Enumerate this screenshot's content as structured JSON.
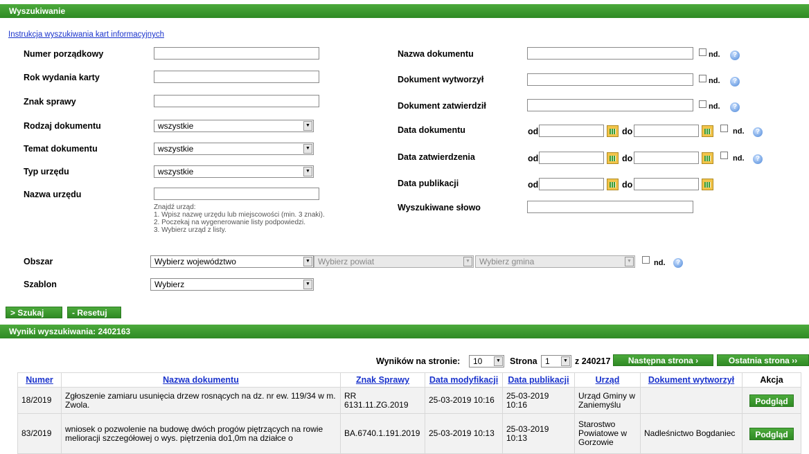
{
  "search_panel": {
    "title": "Wyszukiwanie",
    "instruction_link": "Instrukcja wyszukiwania kart informacyjnych",
    "left_fields": {
      "numer_label": "Numer porządkowy",
      "rok_label": "Rok wydania karty",
      "znak_label": "Znak sprawy",
      "rodzaj_label": "Rodzaj dokumentu",
      "rodzaj_value": "wszystkie",
      "temat_label": "Temat dokumentu",
      "temat_value": "wszystkie",
      "typ_label": "Typ urzędu",
      "typ_value": "wszystkie",
      "nazwa_urzedu_label": "Nazwa urzędu"
    },
    "hint_lines": [
      "Znajdź urząd:",
      "1. Wpisz nazwę urzędu lub miejscowości (min. 3 znaki).",
      "2. Poczekaj na wygenerowanie listy podpowiedzi.",
      "3. Wybierz urząd z listy."
    ],
    "right_fields": {
      "nazwa_dok_label": "Nazwa dokumentu",
      "wytworzyl_label": "Dokument wytworzył",
      "zatwierdzil_label": "Dokument zatwierdził",
      "data_dok_label": "Data dokumentu",
      "data_zatw_label": "Data zatwierdzenia",
      "data_publ_label": "Data publikacji",
      "slowo_label": "Wyszukiwane słowo"
    },
    "nd_label": "nd.",
    "od_label": "od",
    "do_label": "do",
    "obszar": {
      "label": "Obszar",
      "wojewodztwo": "Wybierz województwo",
      "powiat": "Wybierz powiat",
      "gmina": "Wybierz gmina"
    },
    "szablon": {
      "label": "Szablon",
      "value": "Wybierz"
    },
    "search_button": "> Szukaj",
    "reset_button": "- Resetuj"
  },
  "results": {
    "title": "Wyniki wyszukiwania: 2402163",
    "per_page_label": "Wyników na stronie:",
    "per_page_value": "10",
    "page_label": "Strona",
    "page_value": "1",
    "page_total": "z 240217",
    "next_button": "Następna strona ›",
    "last_button": "Ostatnia strona ››",
    "columns": [
      "Numer",
      "Nazwa dokumentu",
      "Znak Sprawy",
      "Data modyfikacji",
      "Data publikacji",
      "Urząd",
      "Dokument wytworzył",
      "Akcja"
    ],
    "rows": [
      {
        "numer": "18/2019",
        "nazwa": "Zgłoszenie zamiaru usunięcia drzew rosnących na dz. nr ew. 119/34 w m. Zwola.",
        "znak": "RR 6131.11.ZG.2019",
        "data_mod": "25-03-2019 10:16",
        "data_publ": "25-03-2019 10:16",
        "urzad": "Urząd Gminy w Zaniemyślu",
        "wytworzyl": "",
        "akcja": "Podgląd"
      },
      {
        "numer": "83/2019",
        "nazwa": "wniosek o pozwolenie na budowę dwóch progów piętrzących na rowie melioracji szczegółowej o wys. piętrzenia do1,0m na działce o",
        "znak": "BA.6740.1.191.2019",
        "data_mod": "25-03-2019 10:13",
        "data_publ": "25-03-2019 10:13",
        "urzad": "Starostwo Powiatowe w Gorzowie",
        "wytworzyl": "Nadleśnictwo Bogdaniec",
        "akcja": "Podgląd"
      }
    ]
  }
}
